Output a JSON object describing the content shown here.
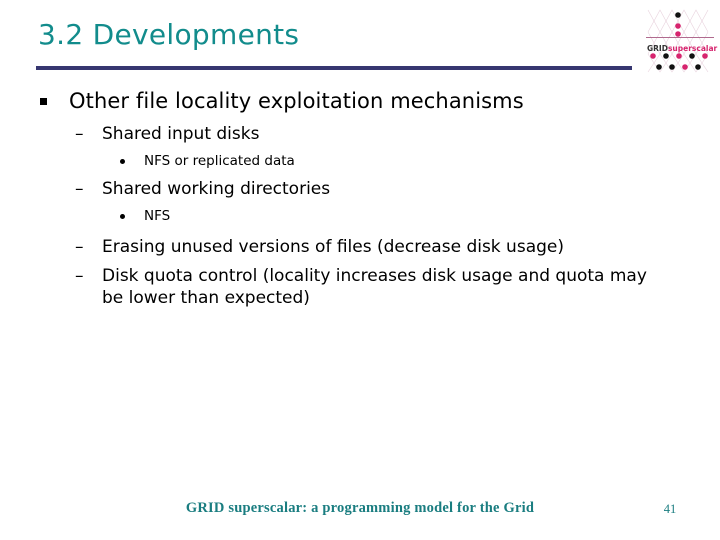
{
  "slide": {
    "title": "3.2 Developments",
    "title_color": "#128c8c",
    "rule_color": "#363670",
    "background": "#ffffff"
  },
  "logo": {
    "name": "grid-superscalar-logo",
    "word_grid": "GRID",
    "word_superscalar": "superscalar",
    "grid_color": "#333333",
    "superscalar_color": "#d6246e",
    "rule_color": "#b06a8e",
    "dot_colors": [
      "#d6246e",
      "#111111"
    ]
  },
  "content": {
    "level1": {
      "marker": "square-bullet",
      "text": "Other file locality exploitation mechanisms"
    },
    "items": [
      {
        "level": 2,
        "marker": "dash-bullet",
        "text": "Shared input disks"
      },
      {
        "level": 3,
        "marker": "round-bullet",
        "text": "NFS or replicated data"
      },
      {
        "level": 2,
        "marker": "dash-bullet",
        "text": "Shared working directories"
      },
      {
        "level": 3,
        "marker": "round-bullet",
        "text": "NFS"
      },
      {
        "level": 2,
        "marker": "dash-bullet",
        "text": "Erasing unused versions of files (decrease disk usage)"
      },
      {
        "level": 2,
        "marker": "dash-bullet",
        "text": "Disk quota control (locality increases disk usage and quota may be lower than expected)"
      }
    ]
  },
  "markers": {
    "dash": "–",
    "dot": "•",
    "square": "▪"
  },
  "footer": {
    "text": "GRID superscalar: a programming model for the Grid",
    "page_number": "41",
    "color": "#1a7d80"
  }
}
